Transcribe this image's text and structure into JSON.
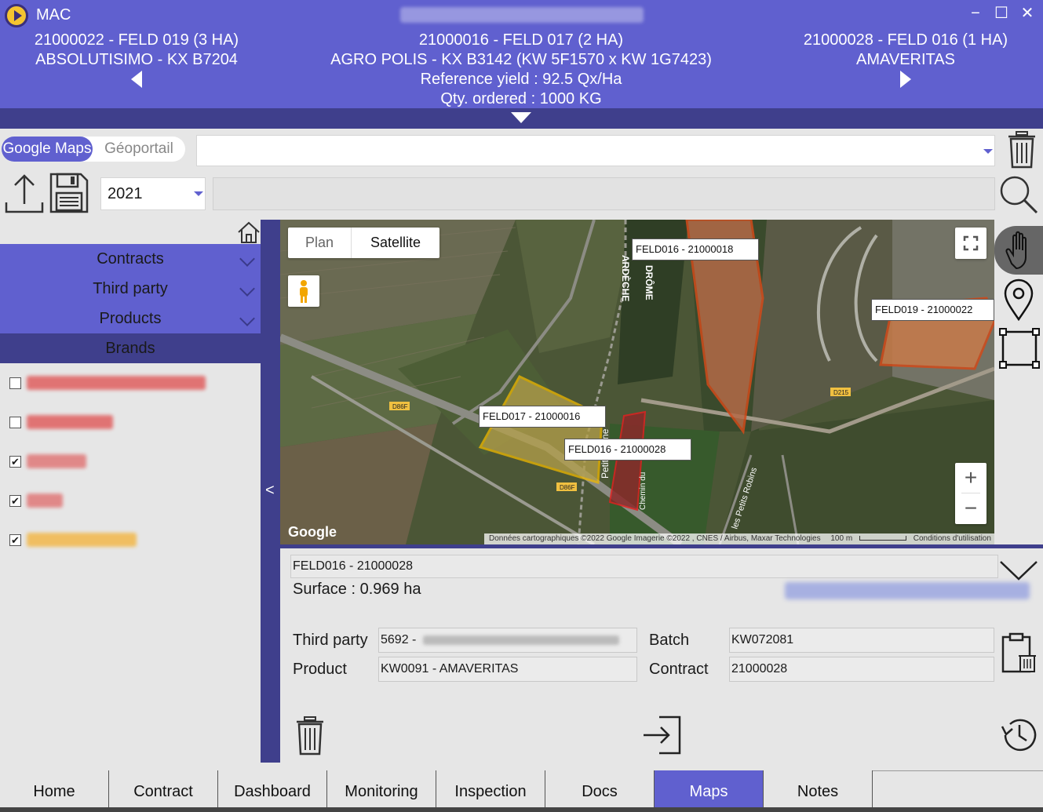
{
  "header": {
    "app_name": "MAC",
    "left": {
      "line1": "21000022 - FELD 019 (3 HA)",
      "line2": "ABSOLUTISIMO - KX B7204"
    },
    "center": {
      "line1": "21000016 - FELD 017 (2 HA)",
      "line2": "AGRO POLIS - KX B3142 (KW 5F1570 x KW 1G7423)",
      "line3": "Reference yield : 92.5 Qx/Ha",
      "line4": "Qty. ordered : 1000 KG"
    },
    "right": {
      "line1": "21000028 - FELD 016 (1 HA)",
      "line2": "AMAVERITAS"
    },
    "window_controls": {
      "minimize": "−",
      "maximize": "☐",
      "close": "✕"
    }
  },
  "toolbar": {
    "map_source_active": "Google Maps",
    "map_source_inactive": "Géoportail",
    "year": "2021"
  },
  "sidebar": {
    "sections": [
      {
        "label": "Contracts"
      },
      {
        "label": "Third party"
      },
      {
        "label": "Products"
      },
      {
        "label": "Brands"
      }
    ],
    "brands": [
      {
        "checked": false,
        "color": "#e05a5a"
      },
      {
        "checked": false,
        "color": "#e05a5a"
      },
      {
        "checked": true,
        "color": "#e07070"
      },
      {
        "checked": true,
        "color": "#e07070"
      },
      {
        "checked": true,
        "color": "#f0b040"
      }
    ],
    "collapse_label": "<"
  },
  "map": {
    "type_plan": "Plan",
    "type_satellite": "Satellite",
    "google_logo": "Google",
    "attribution": "Données cartographiques ©2022 Google Imagerie ©2022 , CNES / Airbus, Maxar Technologies",
    "scale": "100 m",
    "terms": "Conditions d'utilisation",
    "zoom_in": "+",
    "zoom_out": "−",
    "labels": {
      "feld016_18": "FELD016 - 21000018",
      "feld019_22": "FELD019 - 21000022",
      "feld017_16": "FELD017 - 21000016",
      "feld016_28": "FELD016 - 21000028"
    },
    "road_labels": {
      "ardeche": "ARDÈCHE",
      "drome": "DRÔME",
      "d86f": "D86F",
      "d215": "D215",
      "rhone": "Petit-Rhône",
      "chemin": "Chemin du",
      "petits_robins": "les Petits Robins"
    }
  },
  "detail": {
    "field_name": "FELD016 - 21000028",
    "surface": "Surface : 0.969 ha",
    "third_party_label": "Third party",
    "third_party_value": "5692 -",
    "product_label": "Product",
    "product_value": "KW0091 - AMAVERITAS",
    "batch_label": "Batch",
    "batch_value": "KW072081",
    "contract_label": "Contract",
    "contract_value": "21000028"
  },
  "tabs": [
    {
      "label": "Home"
    },
    {
      "label": "Contract"
    },
    {
      "label": "Dashboard"
    },
    {
      "label": "Monitoring"
    },
    {
      "label": "Inspection"
    },
    {
      "label": "Docs"
    },
    {
      "label": "Maps"
    },
    {
      "label": "Notes"
    }
  ]
}
